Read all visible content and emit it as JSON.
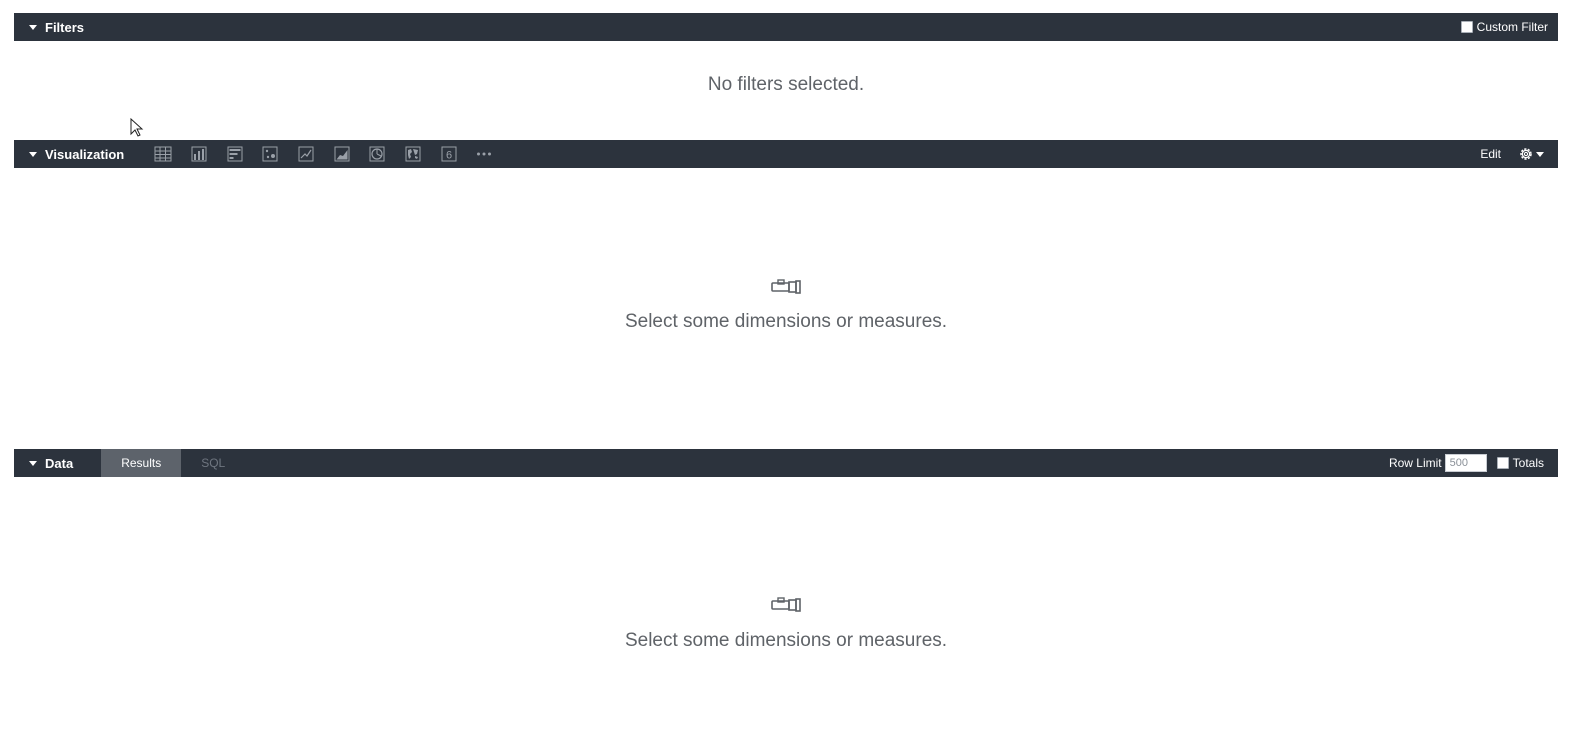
{
  "filters": {
    "title": "Filters",
    "custom_filter_label": "Custom Filter",
    "empty_text": "No filters selected."
  },
  "visualization": {
    "title": "Visualization",
    "types": [
      {
        "icon": "table-icon"
      },
      {
        "icon": "column-chart-icon"
      },
      {
        "icon": "bar-chart-icon"
      },
      {
        "icon": "scatter-chart-icon"
      },
      {
        "icon": "line-chart-icon"
      },
      {
        "icon": "area-chart-icon"
      },
      {
        "icon": "pie-chart-icon"
      },
      {
        "icon": "map-icon"
      },
      {
        "icon": "single-value-icon",
        "label": "6"
      },
      {
        "icon": "more-icon"
      }
    ],
    "edit_label": "Edit",
    "empty_text": "Select some dimensions or measures."
  },
  "data": {
    "title": "Data",
    "tabs": [
      {
        "label": "Results",
        "active": true
      },
      {
        "label": "SQL",
        "active": false
      }
    ],
    "row_limit_label": "Row Limit",
    "row_limit_value": "500",
    "totals_label": "Totals",
    "empty_text": "Select some dimensions or measures."
  },
  "colors": {
    "header_bg": "#2c333d",
    "active_tab_bg": "#5d636b",
    "icon_gray": "#9aa0a8",
    "empty_text": "#5f6368"
  }
}
